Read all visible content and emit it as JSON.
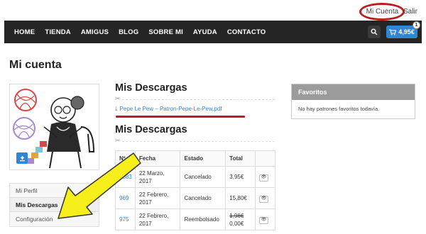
{
  "toplinks": {
    "account": "Mi Cuenta",
    "logout": "Salir"
  },
  "nav": {
    "items": [
      "HOME",
      "TIENDA",
      "AMIGUS",
      "BLOG",
      "SOBRE MI",
      "AYUDA",
      "CONTACTO"
    ],
    "cart_total": "4,95€",
    "cart_count": "1"
  },
  "page_title": "Mi cuenta",
  "sidebar": {
    "menu": [
      {
        "label": "Mi Perfil"
      },
      {
        "label": "Mis Descargas"
      },
      {
        "label": "Configuración"
      }
    ]
  },
  "downloads": {
    "heading": "Mis Descargas",
    "file_link": "Pepe Le Pew – Patron-Pepe-Le-Pew.pdf"
  },
  "orders": {
    "heading": "Mis Descargas",
    "columns": [
      "Nº",
      "Fecha",
      "Estado",
      "Total",
      ""
    ],
    "rows": [
      {
        "num": "1583",
        "date_line1": "22 Marzo,",
        "date_line2": "2017",
        "status": "Cancelado",
        "total": "3,95€",
        "total_old": ""
      },
      {
        "num": "969",
        "date_line1": "22 Febrero,",
        "date_line2": "2017",
        "status": "Cancelado",
        "total": "15,80€",
        "total_old": ""
      },
      {
        "num": "975",
        "date_line1": "22 Febrero,",
        "date_line2": "2017",
        "status": "Reembolsado",
        "total": "0,00€",
        "total_old": "1,98€"
      }
    ]
  },
  "favorites": {
    "heading": "Favoritos",
    "empty_text": "No hay patrones favoritos todavía."
  },
  "colors": {
    "accent": "#2f86d6",
    "navbar": "#252525",
    "annotation_red": "#b81f1f",
    "arrow_yellow": "#f6ef1c"
  }
}
